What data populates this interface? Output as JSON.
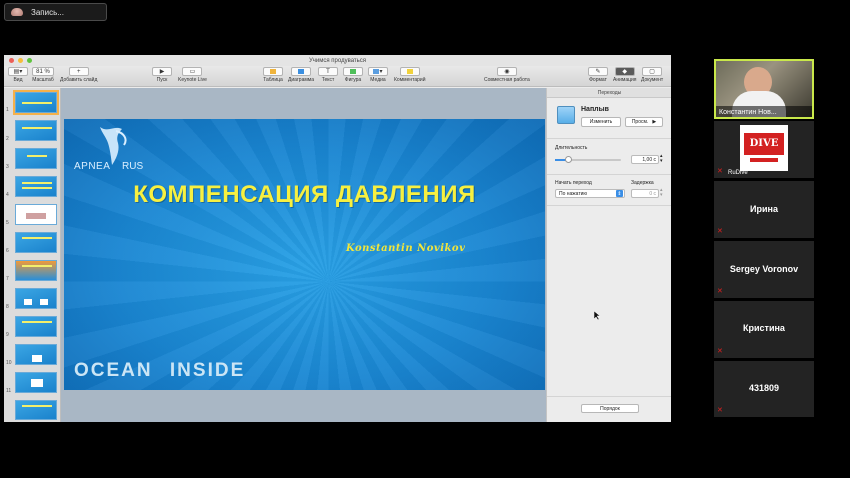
{
  "recording": {
    "label": "Запись..."
  },
  "window": {
    "title": "Учимся продуваться"
  },
  "toolbar": {
    "view": "Вид",
    "zoom_value": "81 %",
    "zoom": "Масштаб",
    "add_slide": "Добавить слайд",
    "play": "Пуск",
    "keynote_live": "Keynote Live",
    "table": "Таблица",
    "chart": "Диаграмма",
    "text": "Текст",
    "shape": "Фигура",
    "media": "Медиа",
    "comment": "Комментарий",
    "collaborate": "Совместная работа",
    "format": "Формат",
    "animate": "Анимация",
    "document": "Документ"
  },
  "thumbnails": [
    "1",
    "2",
    "3",
    "4",
    "5",
    "6",
    "7",
    "8",
    "9",
    "10",
    "11"
  ],
  "slide": {
    "logo_left": "APNEA",
    "logo_right": "RUS",
    "title": "КОМПЕНСАЦИЯ ДАВЛЕНИЯ",
    "author": "Konstantin Novikov",
    "footer": "OCEAN INSIDE"
  },
  "inspector": {
    "tab": "Переходы",
    "transition_name": "Наплыв",
    "change_button": "Изменить",
    "preview_button": "Просм.",
    "duration_label": "Длительность",
    "duration_value": "1,00 с",
    "start_label": "Начать переход",
    "start_value": "По нажатию",
    "delay_label": "Задержка",
    "delay_value": "0 с",
    "order_button": "Порядок"
  },
  "participants": [
    {
      "name": "Константин Нов...",
      "video": true
    },
    {
      "name": "RuDive",
      "video": true
    },
    {
      "name": "Ирина"
    },
    {
      "name": "Sergey Voronov"
    },
    {
      "name": "Кристина"
    },
    {
      "name": "431809"
    }
  ],
  "colors": {
    "accent_yellow": "#f7f040",
    "slide_blue": "#1a86d2",
    "active_speaker": "#c9e84a",
    "muted_red": "#e02020"
  }
}
